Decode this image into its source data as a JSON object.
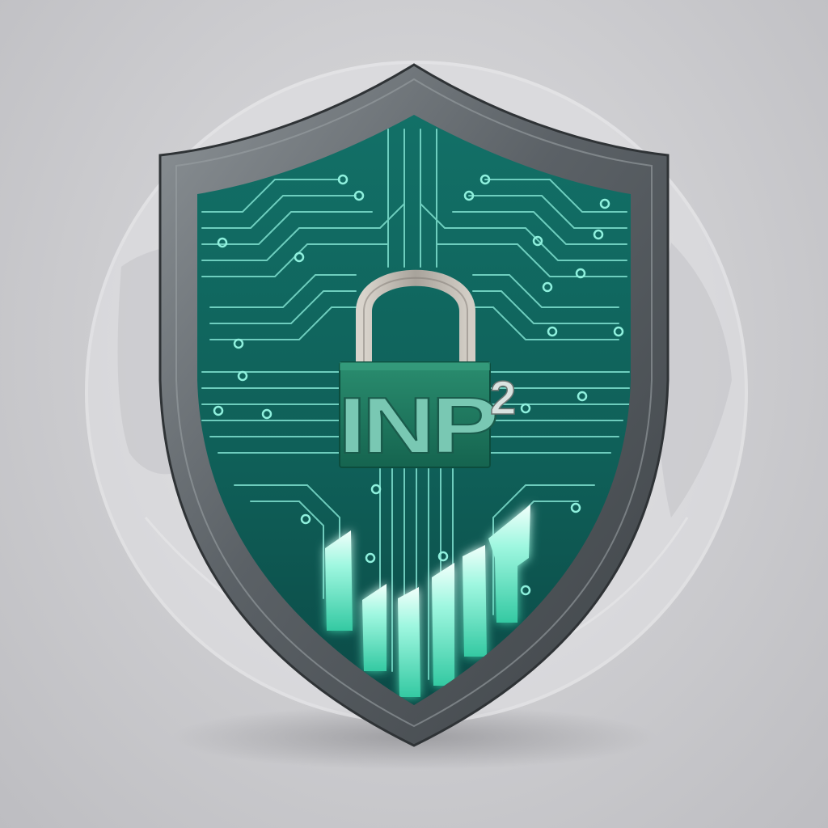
{
  "emblem": {
    "logo_text": "INP",
    "logo_superscript": "2",
    "icons": [
      "globe-icon",
      "shield-icon",
      "circuit-board-pattern",
      "padlock-icon",
      "bar-growth-icon"
    ]
  },
  "colors": {
    "background": "#cfcfd2",
    "shield_frame": "#5d6368",
    "shield_face": "#0f5c55",
    "circuit_trace": "#7fe0cf",
    "lock_body": "#1f7d62",
    "lock_shackle": "#b9b4ad",
    "logo_text": "#7cc9b4",
    "bar_glow": "#8ff5dc"
  }
}
